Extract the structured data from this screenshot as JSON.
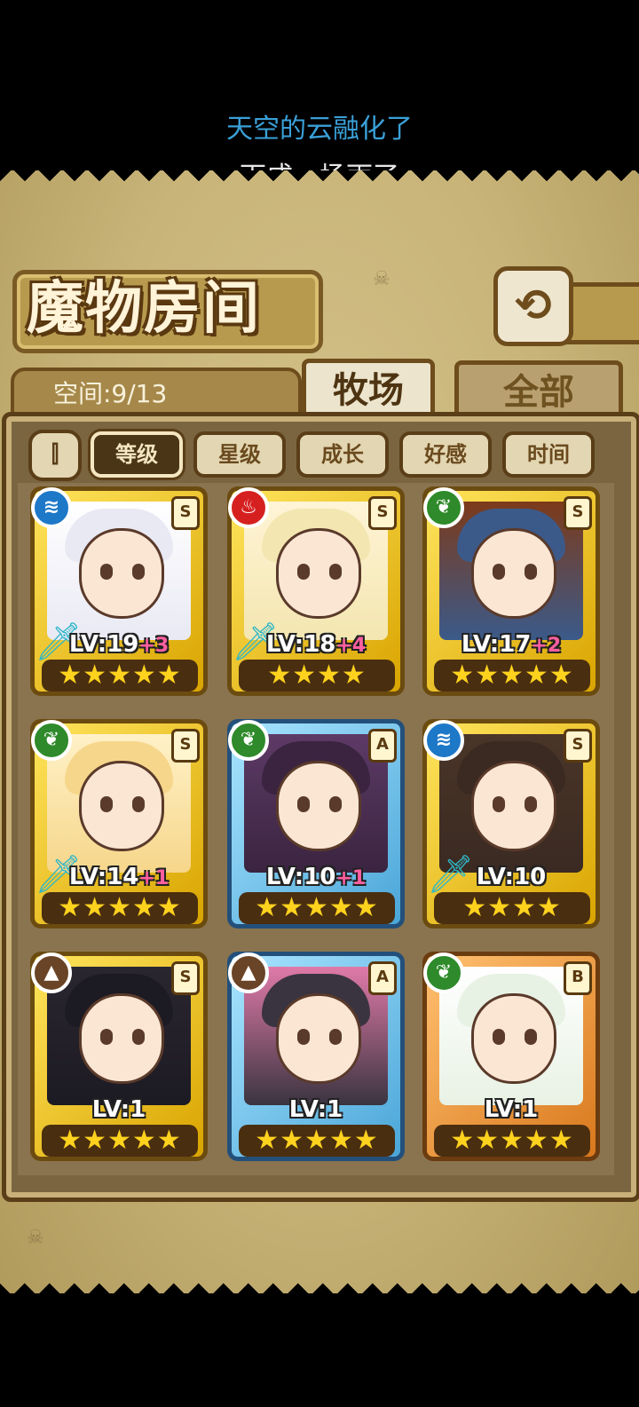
{
  "lyrics": {
    "line1": "天空的云融化了",
    "line2": "下成一场雨了"
  },
  "header": {
    "title": "魔物房间",
    "back_icon": "⟲"
  },
  "space": {
    "label": "空间:9/13"
  },
  "tabs": [
    {
      "label": "牧场",
      "active": true
    },
    {
      "label": "全部",
      "active": false
    }
  ],
  "sort": {
    "toggle_icon": "⫿",
    "chips": [
      {
        "label": "等级",
        "active": true
      },
      {
        "label": "星级",
        "active": false
      },
      {
        "label": "成长",
        "active": false
      },
      {
        "label": "好感",
        "active": false
      },
      {
        "label": "时间",
        "active": false
      }
    ]
  },
  "colors": {
    "gold_frame": "#ffd21e",
    "blue_frame": "#4aa6d8",
    "bronze_frame": "#d9781c",
    "plus_text": "#ff5fa0"
  },
  "monsters": [
    {
      "element": "water",
      "element_icon": "≋",
      "rank": "S",
      "frame": "gold",
      "level": "LV:19",
      "plus": "+3",
      "stars": "★★★★★",
      "weapon": true
    },
    {
      "element": "fire",
      "element_icon": "♨",
      "rank": "S",
      "frame": "gold",
      "level": "LV:18",
      "plus": "+4",
      "stars": "★★★★",
      "weapon": true
    },
    {
      "element": "grass",
      "element_icon": "❦",
      "rank": "S",
      "frame": "gold",
      "level": "LV:17",
      "plus": "+2",
      "stars": "★★★★★",
      "weapon": false
    },
    {
      "element": "grass",
      "element_icon": "❦",
      "rank": "S",
      "frame": "gold",
      "level": "LV:14",
      "plus": "+1",
      "stars": "★★★★★",
      "weapon": true
    },
    {
      "element": "grass",
      "element_icon": "❦",
      "rank": "A",
      "frame": "blue",
      "level": "LV:10",
      "plus": "+1",
      "stars": "★★★★★",
      "weapon": false
    },
    {
      "element": "water",
      "element_icon": "≋",
      "rank": "S",
      "frame": "gold",
      "level": "LV:10",
      "plus": "",
      "stars": "★★★★",
      "weapon": true
    },
    {
      "element": "earth",
      "element_icon": "▲",
      "rank": "S",
      "frame": "gold",
      "level": "LV:1",
      "plus": "",
      "stars": "★★★★★",
      "weapon": false
    },
    {
      "element": "earth",
      "element_icon": "▲",
      "rank": "A",
      "frame": "blue",
      "level": "LV:1",
      "plus": "",
      "stars": "★★★★★",
      "weapon": false
    },
    {
      "element": "grass",
      "element_icon": "❦",
      "rank": "B",
      "frame": "bronze",
      "level": "LV:1",
      "plus": "",
      "stars": "★★★★★",
      "weapon": false
    }
  ]
}
